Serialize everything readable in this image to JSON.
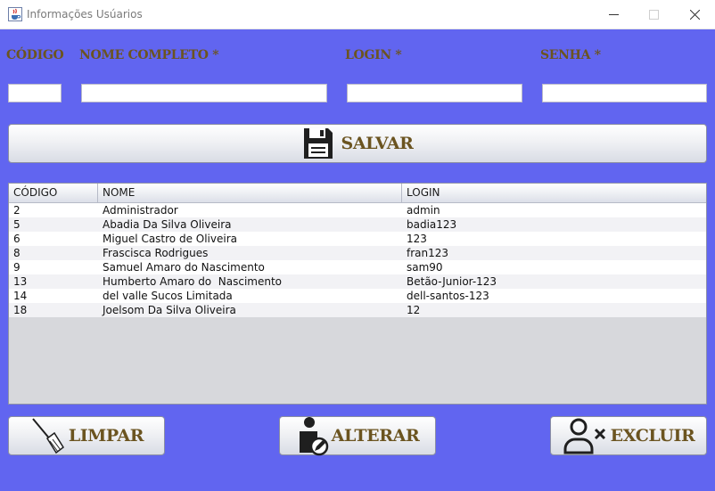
{
  "window": {
    "title": "Informações Usúarios",
    "controls": [
      "minimize-icon",
      "maximize-icon",
      "close-icon"
    ]
  },
  "form": {
    "codigo_label": "CÓDIGO",
    "nome_label": "NOME COMPLETO *",
    "login_label": "LOGIN *",
    "senha_label": "SENHA *",
    "codigo_value": "",
    "nome_value": "",
    "login_value": "",
    "senha_value": ""
  },
  "buttons": {
    "salvar": "SALVAR",
    "limpar": "LIMPAR",
    "alterar": "ALTERAR",
    "excluir": "EXCLUIR"
  },
  "table": {
    "headers": [
      "CÓDIGO",
      "NOME",
      "LOGIN"
    ],
    "rows": [
      [
        "2",
        "Administrador",
        "admin"
      ],
      [
        "5",
        "Abadia Da Silva Oliveira",
        "badia123"
      ],
      [
        "6",
        "Miguel Castro de Oliveira",
        "123"
      ],
      [
        "8",
        "Frascisca Rodrigues",
        "fran123"
      ],
      [
        "9",
        "Samuel Amaro do Nascimento",
        "sam90"
      ],
      [
        "13",
        "Humberto Amaro do  Nascimento",
        "Betão-Junior-123"
      ],
      [
        "14",
        "del valle Sucos Limitada",
        "dell-santos-123"
      ],
      [
        "18",
        "Joelsom Da Silva Oliveira",
        "12"
      ]
    ]
  },
  "colors": {
    "background": "#6165f0",
    "label_text": "#6b5420",
    "table_empty": "#d7d8dc"
  },
  "icons": {
    "salvar": "floppy-disk-icon",
    "limpar": "broom-icon",
    "alterar": "user-edit-icon",
    "excluir": "user-remove-icon",
    "app": "java-cup-icon"
  }
}
